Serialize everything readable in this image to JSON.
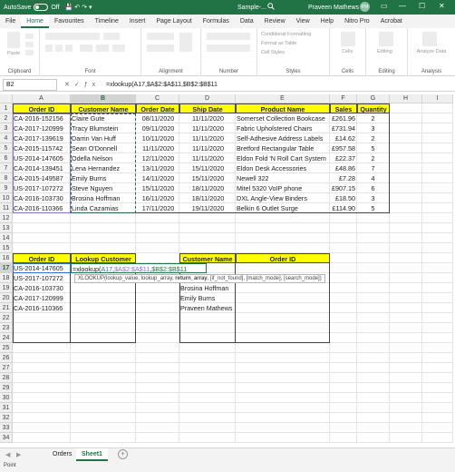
{
  "titlebar": {
    "autosave": "AutoSave",
    "toggle": "Off",
    "filename": "Sample-...",
    "user": "Praveen Mathews",
    "avatar": "PM"
  },
  "tabs": [
    "File",
    "Home",
    "Favourites",
    "Timeline",
    "Insert",
    "Page Layout",
    "Formulas",
    "Data",
    "Review",
    "View",
    "Help",
    "Nitro Pro",
    "Acrobat"
  ],
  "ribbon": {
    "groups": [
      "Clipboard",
      "Font",
      "Alignment",
      "Number",
      "Styles",
      "Cells",
      "Editing",
      "Analysis"
    ],
    "paste": "Paste",
    "styles": [
      "Conditional Formatting",
      "Format as Table",
      "Cell Styles"
    ],
    "cells": "Cells",
    "editing": "Editing",
    "analyze": "Analyze Data"
  },
  "formula_bar": {
    "name_box": "B2",
    "formula": "=xlookup(A17,$A$2:$A$11,$B$2:$B$11"
  },
  "columns": [
    "A",
    "B",
    "C",
    "D",
    "E",
    "F",
    "G",
    "H",
    "I"
  ],
  "rows": [
    "1",
    "2",
    "3",
    "4",
    "5",
    "6",
    "7",
    "8",
    "9",
    "10",
    "11",
    "12",
    "13",
    "14",
    "15",
    "16",
    "17",
    "18",
    "19",
    "20",
    "21",
    "22",
    "23",
    "24",
    "25",
    "26",
    "27",
    "28",
    "29",
    "30",
    "31",
    "32",
    "33",
    "34"
  ],
  "orders_table": {
    "headers": [
      "Order ID",
      "Customer Name",
      "Order Date",
      "Ship Date",
      "Product Name",
      "Sales",
      "Quantity"
    ],
    "rows": [
      [
        "CA-2016-152156",
        "Claire Gute",
        "08/11/2020",
        "11/11/2020",
        "Somerset Collection Bookcase",
        "£261.96",
        "2"
      ],
      [
        "CA-2017-120999",
        "Tracy Blumstein",
        "09/11/2020",
        "11/11/2020",
        "Fabric Upholstered Chairs",
        "£731.94",
        "3"
      ],
      [
        "CA-2017-139619",
        "Darrin Van Huff",
        "10/11/2020",
        "11/11/2020",
        "Self-Adhesive Address Labels",
        "£14.62",
        "2"
      ],
      [
        "CA-2015-115742",
        "Sean O'Donnell",
        "11/11/2020",
        "11/11/2020",
        "Bretford Rectangular Table",
        "£957.58",
        "5"
      ],
      [
        "US-2014-147605",
        "Odella Nelson",
        "12/11/2020",
        "11/11/2020",
        "Eldon Fold 'N Roll Cart System",
        "£22.37",
        "2"
      ],
      [
        "CA-2014-139451",
        "Lena Hernandez",
        "13/11/2020",
        "15/11/2020",
        "Eldon Desk Accessories",
        "£48.86",
        "7"
      ],
      [
        "CA-2015-149587",
        "Emily Burns",
        "14/11/2020",
        "15/11/2020",
        "Newell 322",
        "£7.28",
        "4"
      ],
      [
        "US-2017-107272",
        "Steve Nguyen",
        "15/11/2020",
        "18/11/2020",
        "Mitel 5320 VoIP phone",
        "£907.15",
        "6"
      ],
      [
        "CA-2016-103730",
        "Brosina Hoffman",
        "16/11/2020",
        "18/11/2020",
        "DXL Angle-View Binders",
        "£18.50",
        "3"
      ],
      [
        "CA-2016-110366",
        "Linda Cazamias",
        "17/11/2020",
        "19/11/2020",
        "Belkin 6 Outlet Surge",
        "£114.90",
        "5"
      ]
    ]
  },
  "lookup_table": {
    "headers": [
      "Order ID",
      "Lookup Customer"
    ],
    "rows": [
      "US-2014-147605",
      "US-2017-107272",
      "CA-2016-103730",
      "CA-2017-120999",
      "CA-2016-110366"
    ],
    "editing_formula_prefix": "=xlookup(",
    "editing_formula_ref1": "A17",
    "editing_formula_sep1": ",",
    "editing_formula_ref2": "$A$2:$A$11",
    "editing_formula_sep2": ",",
    "editing_formula_ref3": "$B$2:$B$11",
    "tooltip_prefix": "XLOOKUP(lookup_value, lookup_array, ",
    "tooltip_bold": "return_array",
    "tooltip_suffix": ", [if_not_found], [match_mode], [search_mode])"
  },
  "reverse_table": {
    "headers": [
      "Customer Name",
      "Order ID"
    ],
    "rows": [
      "Brosina Hoffman",
      "Emily Burns",
      "Praveen Mathews"
    ]
  },
  "sheets": [
    "Orders",
    "Sheet1"
  ],
  "active_sheet": "Sheet1",
  "status": "Point",
  "colors": {
    "excel_green": "#217346",
    "header_yellow": "#ffff00"
  }
}
